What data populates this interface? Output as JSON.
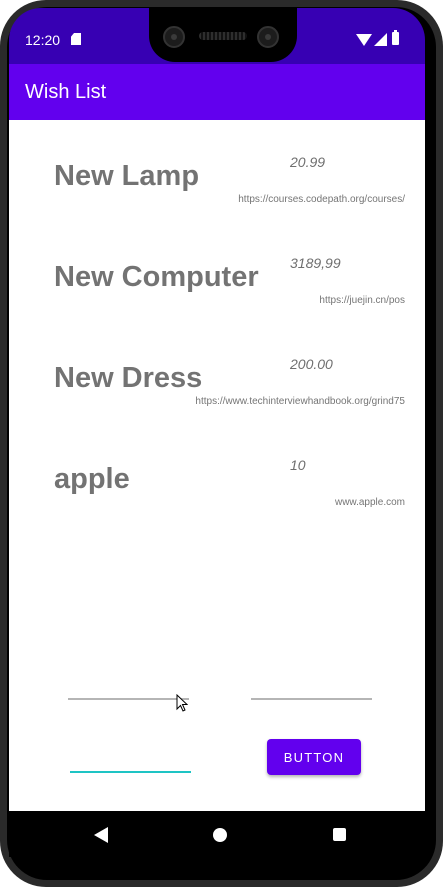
{
  "status_bar": {
    "time": "12:20",
    "icons": [
      "sd-card-icon",
      "wifi-icon",
      "signal-icon",
      "battery-icon"
    ],
    "background": "#3700b3"
  },
  "app_bar": {
    "title": "Wish List",
    "background": "#6200ee"
  },
  "wishlist": {
    "items": [
      {
        "name": "New Lamp",
        "price": "20.99",
        "url": "https://courses.codepath.org/courses/"
      },
      {
        "name": "New Computer",
        "price": "3189,99",
        "url": "https://juejin.cn/pos"
      },
      {
        "name": "New Dress",
        "price": "200.00",
        "url": "https://www.techinterviewhandbook.org/grind75"
      },
      {
        "name": "apple",
        "price": "10",
        "url": "www.apple.com"
      }
    ]
  },
  "form": {
    "button_label": "BUTTON",
    "field_accent": "#1ec4c4"
  },
  "nav_bar": {
    "icons": [
      "back-icon",
      "home-icon",
      "recents-icon"
    ]
  }
}
